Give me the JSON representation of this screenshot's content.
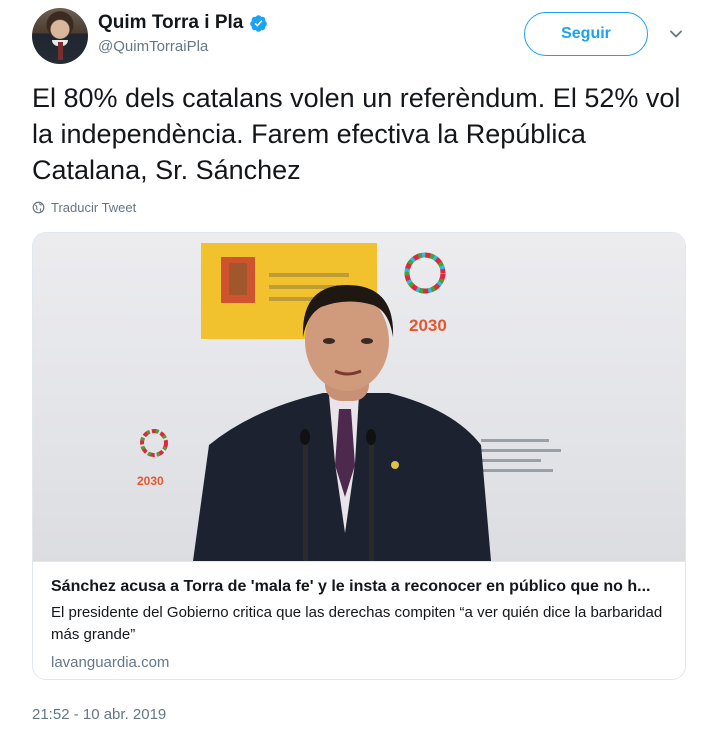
{
  "author": {
    "name": "Quim Torra i Pla",
    "handle": "@QuimTorraiPla",
    "verified": true
  },
  "follow_button": {
    "label": "Seguir"
  },
  "tweet": {
    "text": "El 80% dels catalans volen un referèndum. El 52% vol la independència. Farem efectiva la República Catalana, Sr. Sánchez",
    "translate_label": "Traducir Tweet",
    "timestamp": "21:52 - 10 abr. 2019"
  },
  "card": {
    "title": "Sánchez acusa a Torra de 'mala fe' y le insta a reconocer en público que no h...",
    "description": "El presidente del Gobierno critica que las derechas compiten “a ver quién dice la barbaridad más grande”",
    "domain": "lavanguardia.com",
    "image_text": {
      "backdrop_year": "2030"
    }
  },
  "colors": {
    "accent": "#1da1f2",
    "text": "#14171a",
    "secondary": "#657786",
    "border": "#e1e8ed",
    "flag_yellow": "#f2c12e"
  },
  "icons": [
    "verified-icon",
    "chevron-down-icon",
    "globe-icon"
  ]
}
